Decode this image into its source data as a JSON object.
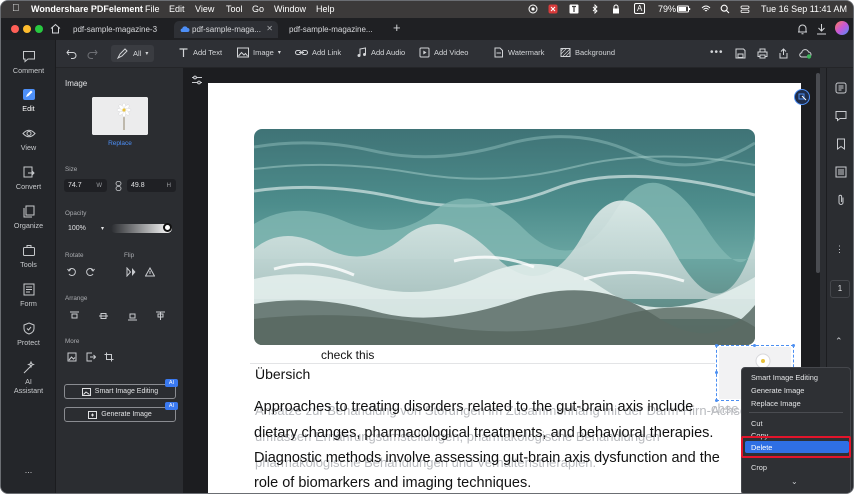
{
  "menubar": {
    "app_name": "Wondershare PDFelement",
    "items": [
      "File",
      "Edit",
      "View",
      "Tool",
      "Go",
      "Window",
      "Help"
    ],
    "battery": "79%",
    "datetime": "Tue 16 Sep  11:41 AM",
    "input_badge": "A"
  },
  "tabs": [
    {
      "label": "pdf-sample-magazine-3"
    },
    {
      "label": "pdf-sample-maga..."
    },
    {
      "label": "pdf-sample-magazine..."
    }
  ],
  "toolbar": {
    "all_label": "All",
    "add_text": "Add Text",
    "image": "Image",
    "add_link": "Add Link",
    "add_audio": "Add Audio",
    "add_video": "Add Video",
    "watermark": "Watermark",
    "background": "Background"
  },
  "rail": [
    {
      "label": "Comment",
      "icon": "comment-icon"
    },
    {
      "label": "Edit",
      "icon": "edit-icon"
    },
    {
      "label": "View",
      "icon": "view-icon"
    },
    {
      "label": "Convert",
      "icon": "convert-icon"
    },
    {
      "label": "Organize",
      "icon": "organize-icon"
    },
    {
      "label": "Tools",
      "icon": "tools-icon"
    },
    {
      "label": "Form",
      "icon": "form-icon"
    },
    {
      "label": "Protect",
      "icon": "protect-icon"
    },
    {
      "label": "AI",
      "label2": "Assistant",
      "icon": "ai-assistant-icon"
    },
    {
      "label": "...",
      "icon": "more-icon"
    }
  ],
  "panel": {
    "title": "Image",
    "replace": "Replace",
    "size_label": "Size",
    "width": "74.7",
    "width_unit": "W",
    "height": "49.8",
    "height_unit": "H",
    "opacity_label": "Opacity",
    "opacity": "100%",
    "opacity_fraction": 1.0,
    "rotate_label": "Rotate",
    "flip_label": "Flip",
    "arrange_label": "Arrange",
    "more_label": "More",
    "smart_image_editing": "Smart Image Editing",
    "generate_image": "Generate Image",
    "ai_badge": "AI"
  },
  "document": {
    "annotation": "check this",
    "heading": "Übersich",
    "lines": [
      "Approaches to treating disorders related to the gut-brain axis include",
      "dietary changes, pharmacological treatments, and behavioral therapies.",
      "Diagnostic methods involve assessing gut-brain axis dysfunction and the",
      "role of biomarkers and imaging techniques."
    ],
    "ghost_lines": [
      "Ansätze zur Behandlung von Störungen im Zusammenhang mit der Darm-Hirn-Achse",
      "umfassen Ernährungsumstellungen, pharmakologische Behandlungen",
      "pharmakologische Behandlungen und Verhaltenstherapien."
    ],
    "ghost_right": "chse"
  },
  "page_number": "1",
  "context_menu": {
    "items": [
      "Smart Image Editing",
      "Generate Image",
      "Replace Image",
      "Cut",
      "Copy",
      "Delete",
      "Crop"
    ],
    "selected": "Delete"
  },
  "colors": {
    "accent": "#2f6fe4",
    "highlight_box": "#e3142b",
    "link": "#4d8ff7"
  }
}
